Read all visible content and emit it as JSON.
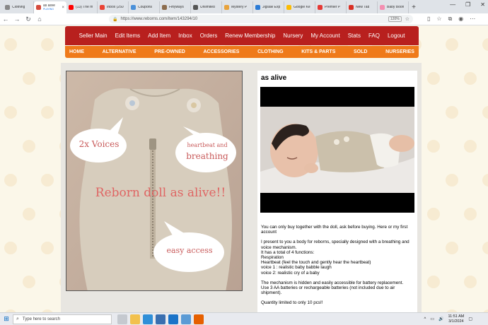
{
  "browser": {
    "tabs": [
      {
        "title": "Clothing",
        "color": "#888888"
      },
      {
        "title": "as alive",
        "subtitle": "PLAYING",
        "color": "#d54b3d",
        "active": true
      },
      {
        "title": "(13) The m",
        "color": "#ff0000"
      },
      {
        "title": "Inbox (250",
        "color": "#ea4335"
      },
      {
        "title": "Coupons",
        "color": "#4a90d9"
      },
      {
        "title": "Fiftyways",
        "color": "#8c6d4e"
      },
      {
        "title": "Unlimited",
        "color": "#555555"
      },
      {
        "title": "Mystery P",
        "color": "#e8a33d"
      },
      {
        "title": "Jigsaw Exp",
        "color": "#2b7bd6"
      },
      {
        "title": "Google Ke",
        "color": "#fbbc04"
      },
      {
        "title": "Premier P",
        "color": "#e53935"
      },
      {
        "title": "New Tab",
        "color": "#d93025"
      },
      {
        "title": "Baby Boon",
        "color": "#f48fb1"
      }
    ],
    "url": "https://www.reborns.com/item/143294/10",
    "zoom": "120%"
  },
  "nav_primary": [
    "Seller Main",
    "Edit Items",
    "Add Item",
    "Inbox",
    "Orders",
    "Renew Membership",
    "Nursery",
    "My Account",
    "Stats",
    "FAQ",
    "Logout"
  ],
  "nav_secondary": [
    "HOME",
    "ALTERNATIVE",
    "PRE-OWNED",
    "ACCESSORIES",
    "CLOTHING",
    "KITS & PARTS",
    "SOLD",
    "NURSERIES"
  ],
  "photo_text": {
    "bubble1": "2x Voices",
    "bubble2_line1": "heartbeat and",
    "bubble2_line2": "breathing",
    "headline": "Reborn doll as alive!!",
    "bubble3": "easy access"
  },
  "product": {
    "title": "as alive",
    "desc_p1": "You can only buy together with the doll, ask before buying. Here or my first account",
    "desc_p2_lines": [
      "I present to you a body for reborns, specially designed with a breathing and voice mechanism.",
      "It has a total of 4 functions:",
      "Respiration",
      "Heartbeat (feel the touch and gently hear the heartbeat)",
      "voice 1 : realistic baby babble laugh",
      "voice 2: realistic cry of a baby"
    ],
    "desc_p3_lines": [
      "The mechanism is hidden and easily accessible for battery replacement.",
      "Use 3 AA batteries or rechargeable batteries (not included due to air shipment)."
    ],
    "desc_p4": "Quantity limited to only 10 pcs!!"
  },
  "taskbar": {
    "search_placeholder": "Type here to search",
    "time": "11:51 AM",
    "date": "3/1/2024"
  },
  "colors": {
    "nav_red": "#b8201e",
    "nav_orange": "#ef7a1a",
    "page_bg": "#fbf7e9"
  }
}
